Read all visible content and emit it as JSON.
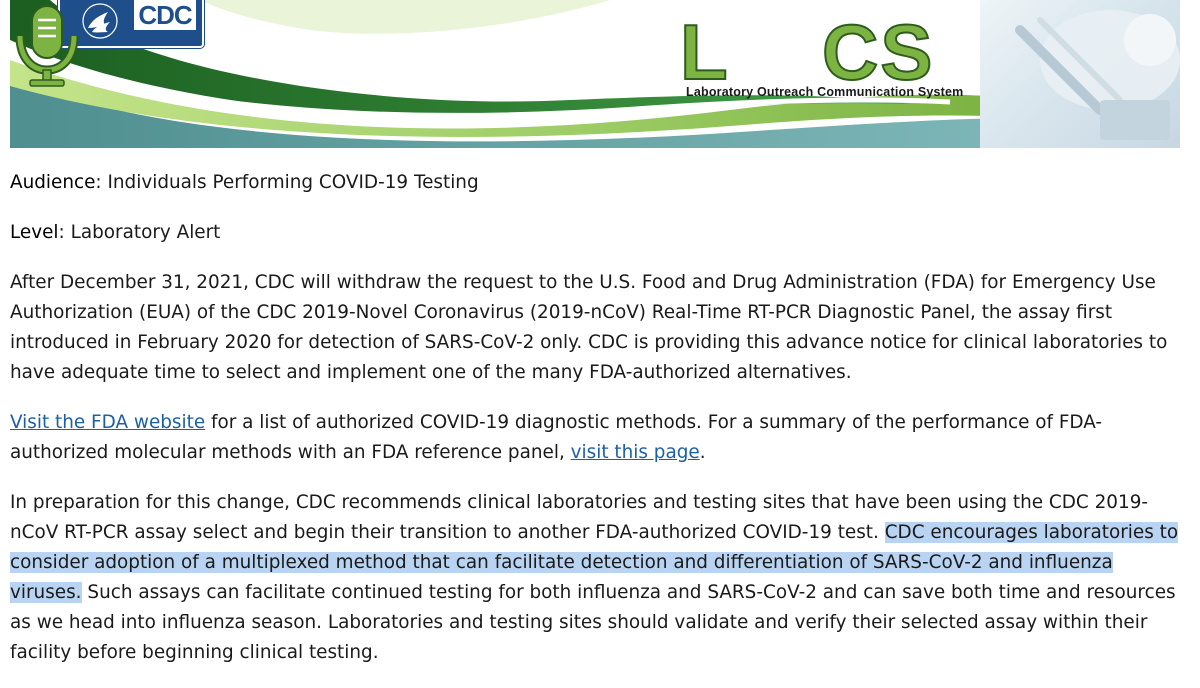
{
  "banner": {
    "cdc_logo_text": "CDC",
    "lucs_letters_left": "L",
    "lucs_letters_right": "CS",
    "subtitle": "Laboratory Outreach Communication System",
    "colors": {
      "cdc_blue": "#1f4f8b",
      "lucs_green": "#7cb342",
      "lucs_outline": "#2e5c1c",
      "swoosh_dark_green": "#2e7d32",
      "swoosh_light_green": "#a5d65b",
      "swoosh_teal": "#4a9a9c"
    }
  },
  "audience": {
    "label": "Audience",
    "sep": ": ",
    "value": "Individuals Performing COVID-19 Testing"
  },
  "level": {
    "label": "Level",
    "sep": ": ",
    "value": "Laboratory Alert"
  },
  "para1": "After December 31, 2021, CDC will withdraw the request to the U.S. Food and Drug Administration (FDA) for Emergency Use Authorization (EUA) of the CDC 2019-Novel Coronavirus (2019-nCoV) Real-Time RT-PCR Diagnostic Panel, the assay first introduced in February 2020 for detection of SARS-CoV-2 only. CDC is providing this advance notice for clinical laboratories to have adequate time to select and implement one of the many FDA-authorized alternatives.",
  "para2": {
    "link1": "Visit the FDA website",
    "text1": " for a list of authorized COVID-19 diagnostic methods. For a summary of the performance of FDA-authorized molecular methods with an FDA reference panel, ",
    "link2": "visit this page",
    "text2": "."
  },
  "para3": {
    "before": "In preparation for this change, CDC recommends clinical laboratories and testing sites that have been using the CDC 2019-nCoV RT-PCR assay select and begin their transition to another FDA-authorized COVID-19 test. ",
    "highlight": "CDC encourages laboratories to consider adoption of a multiplexed method that can facilitate detection and differentiation of SARS-CoV-2 and influenza viruses.",
    "after": " Such assays can facilitate continued testing for both influenza and SARS-CoV-2 and can save both time and resources as we head into influenza season. Laboratories and testing sites should validate and verify their selected assay within their facility before beginning clinical testing."
  },
  "highlight_color": "#b9d3f2",
  "link_color": "#1d5fa6"
}
